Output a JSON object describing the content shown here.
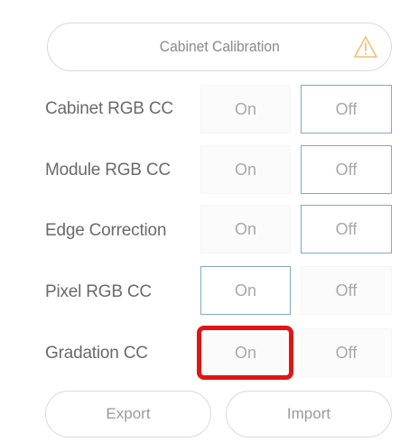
{
  "calibration": {
    "label": "Cabinet Calibration",
    "warning_icon": "warning-triangle-icon",
    "warning_color": "#f0c070"
  },
  "rows": [
    {
      "label": "Cabinet RGB CC",
      "on_label": "On",
      "off_label": "Off",
      "selected": "Off"
    },
    {
      "label": "Module RGB CC",
      "on_label": "On",
      "off_label": "Off",
      "selected": "Off"
    },
    {
      "label": "Edge Correction",
      "on_label": "On",
      "off_label": "Off",
      "selected": "Off"
    },
    {
      "label": "Pixel RGB CC",
      "on_label": "On",
      "off_label": "Off",
      "selected": "On"
    },
    {
      "label": "Gradation CC",
      "on_label": "On",
      "off_label": "Off",
      "selected": "none"
    }
  ],
  "buttons": {
    "export_label": "Export",
    "import_label": "Import"
  },
  "colors": {
    "selected_border": "#7fa9c4",
    "highlight_box": "#e01616"
  }
}
